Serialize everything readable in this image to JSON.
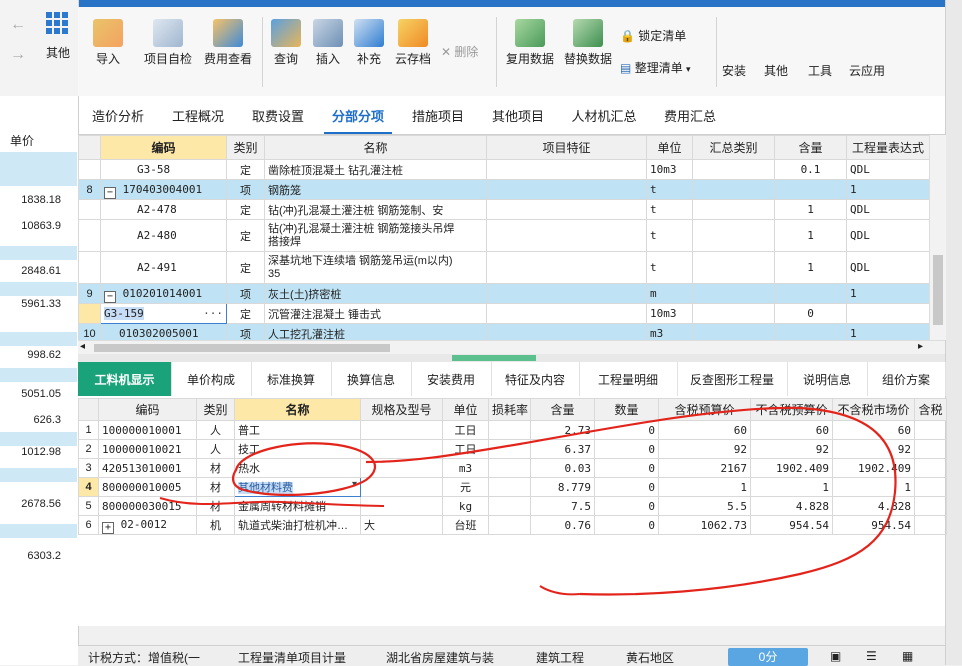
{
  "left_nav": {
    "other_label": "其他"
  },
  "ribbon": {
    "import": "导入",
    "self_check": "项目自检",
    "fee_view": "费用查看",
    "query": "查询",
    "insert": "插入",
    "supplement": "补充",
    "cloud": "云存档",
    "delete": "删除",
    "reuse": "复用数据",
    "replace": "替换数据",
    "lock_list": "锁定清单",
    "organize_list": "整理清单",
    "install": "安装",
    "other": "其他",
    "tools": "工具",
    "cloud_app": "云应用"
  },
  "tabs": [
    "造价分析",
    "工程概况",
    "取费设置",
    "分部分项",
    "措施项目",
    "其他项目",
    "人材机汇总",
    "费用汇总"
  ],
  "price_col": {
    "header": "单价",
    "values": [
      "1838.18",
      "10863.9",
      "2848.61",
      "5961.33",
      "998.62",
      "5051.05",
      "626.3",
      "1012.98",
      "2678.56",
      "6303.2"
    ]
  },
  "upper_grid": {
    "headers": [
      "编码",
      "类别",
      "名称",
      "项目特征",
      "单位",
      "汇总类别",
      "含量",
      "工程量表达式"
    ],
    "rows": [
      {
        "no": "",
        "code": "G3-58",
        "type": "定",
        "name": "凿除桩顶混凝土 钻孔灌注桩",
        "unit": "10m3",
        "qty": "0.1",
        "expr": "QDL"
      },
      {
        "no": "8",
        "code": "170403004001",
        "type": "项",
        "name": "钢筋笼",
        "unit": "t",
        "qty": "",
        "expr": "1"
      },
      {
        "no": "",
        "code": "A2-478",
        "type": "定",
        "name": "钻(冲)孔混凝土灌注桩 钢筋笼制、安",
        "unit": "t",
        "qty": "1",
        "expr": "QDL"
      },
      {
        "no": "",
        "code": "A2-480",
        "type": "定",
        "name": "钻(冲)孔混凝土灌注桩 钢筋笼接头吊焊",
        "name2": "搭接焊",
        "unit": "t",
        "qty": "1",
        "expr": "QDL"
      },
      {
        "no": "",
        "code": "A2-491",
        "type": "定",
        "name": "深基坑地下连续墙 钢筋笼吊运(m以内)",
        "name2": "35",
        "unit": "t",
        "qty": "1",
        "expr": "QDL"
      },
      {
        "no": "9",
        "code": "010201014001",
        "type": "项",
        "name": "灰土(土)挤密桩",
        "unit": "m",
        "qty": "",
        "expr": "1"
      },
      {
        "no": "",
        "code": "G3-159",
        "type": "定",
        "name": "沉管灌注混凝土 锤击式",
        "unit": "10m3",
        "qty": "0",
        "expr": ""
      },
      {
        "no": "10",
        "code": "010302005001",
        "type": "项",
        "name": "人工挖孔灌注桩",
        "unit": "m3",
        "qty": "",
        "expr": "1"
      }
    ]
  },
  "bottom_tabs": [
    "工料机显示",
    "单价构成",
    "标准换算",
    "换算信息",
    "安装费用",
    "特征及内容",
    "工程量明细",
    "反查图形工程量",
    "说明信息",
    "组价方案"
  ],
  "lower_grid": {
    "headers": [
      "编码",
      "类别",
      "名称",
      "规格及型号",
      "单位",
      "损耗率",
      "含量",
      "数量",
      "含税预算价",
      "不含税预算价",
      "不含税市场价",
      "含税"
    ],
    "rows": [
      {
        "no": "1",
        "code": "100000010001",
        "type": "人",
        "name": "普工",
        "spec": "",
        "unit": "工日",
        "qty": "2.73",
        "count": "0",
        "p1": "60",
        "p2": "60",
        "p3": "60"
      },
      {
        "no": "2",
        "code": "100000010021",
        "type": "人",
        "name": "技工",
        "spec": "",
        "unit": "工日",
        "qty": "6.37",
        "count": "0",
        "p1": "92",
        "p2": "92",
        "p3": "92"
      },
      {
        "no": "3",
        "code": "420513010001",
        "type": "材",
        "name": "热水",
        "spec": "",
        "unit": "m3",
        "qty": "0.03",
        "count": "0",
        "p1": "2167",
        "p2": "1902.409",
        "p3": "1902.409"
      },
      {
        "no": "4",
        "code": "800000010005",
        "type": "材",
        "name": "其他材料费",
        "spec": "",
        "unit": "元",
        "qty": "8.779",
        "count": "0",
        "p1": "1",
        "p2": "1",
        "p3": "1"
      },
      {
        "no": "5",
        "code": "800000030015",
        "type": "材",
        "name": "金属周转材料摊销",
        "spec": "",
        "unit": "kg",
        "qty": "7.5",
        "count": "0",
        "p1": "5.5",
        "p2": "4.828",
        "p3": "4.828"
      },
      {
        "no": "6",
        "code": "02-0012",
        "type": "机",
        "name": "轨道式柴油打桩机冲…",
        "spec": "大",
        "unit": "台班",
        "qty": "0.76",
        "count": "0",
        "p1": "1062.73",
        "p2": "954.54",
        "p3": "954.54"
      }
    ]
  },
  "status": {
    "calc": "计税方式：增值税(一",
    "rule": "工程量清单项目计量",
    "region_std": "湖北省房屋建筑与装",
    "discipline": "建筑工程",
    "area": "黄石地区",
    "score": "0分"
  }
}
